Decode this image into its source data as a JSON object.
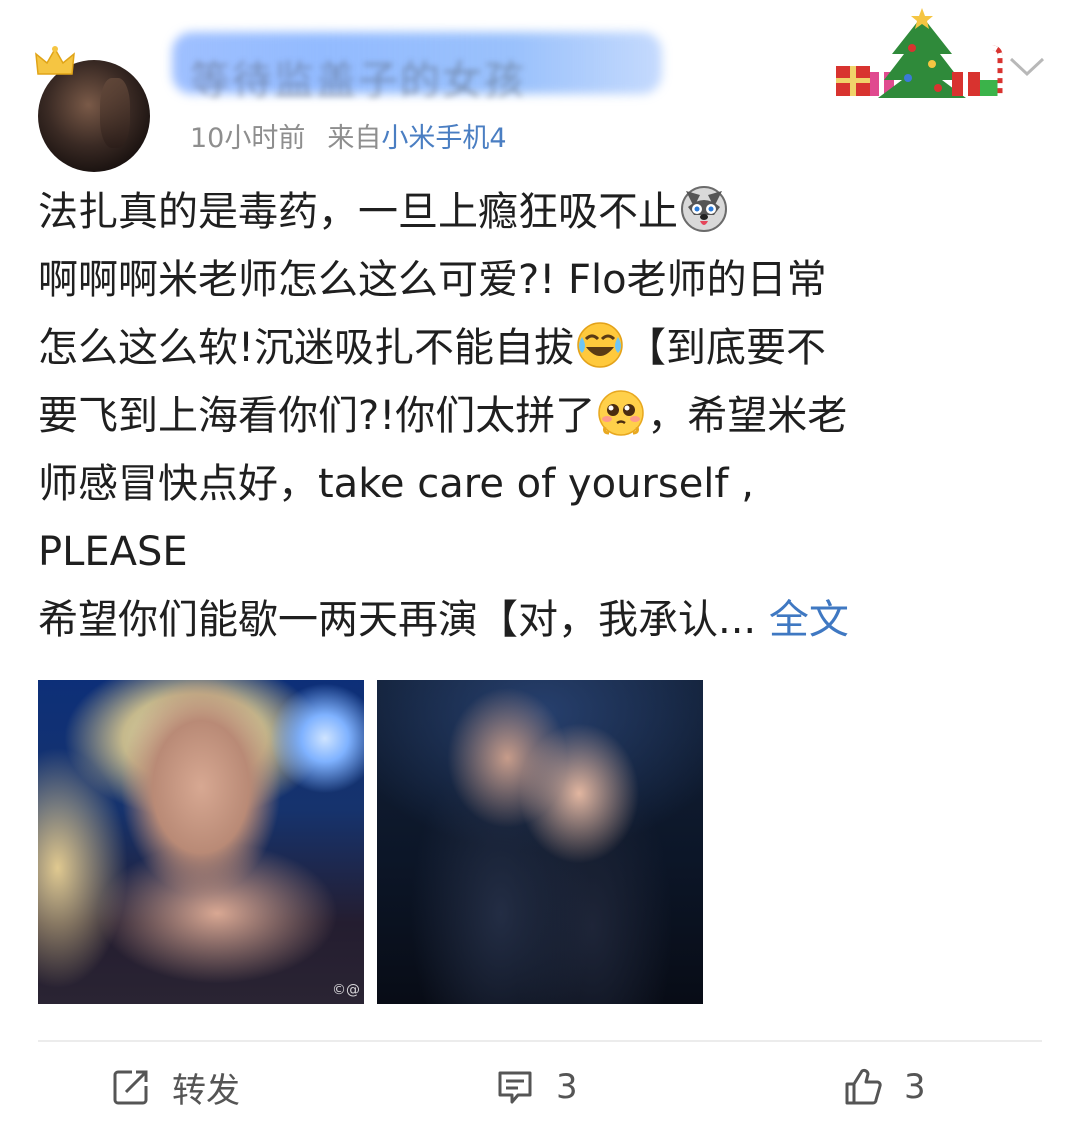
{
  "header": {
    "username_obscured": "等待监盖子的女孩",
    "time": "10小时前",
    "source_prefix": "来自",
    "source": "小米手机4"
  },
  "post": {
    "lines": [
      "法扎真的是毒药，一旦上瘾狂吸不止",
      "啊啊啊米老师怎么这么可爱?!  Flo老师的日常",
      "怎么这么软!沉迷吸扎不能自拔",
      "【到底要不",
      "要飞到上海看你们?!你们太拼了",
      "，希望米老",
      "师感冒快点好，take care of yourself ,",
      "PLEASE",
      "希望你们能歇一两天再演【对，我承认... "
    ],
    "full_text_link": "全文",
    "emojis": [
      "husky-emoji",
      "laughing-crying-emoji",
      "pleading-emoji"
    ]
  },
  "photos": {
    "watermark": "©@"
  },
  "actions": {
    "repost_label": "转发",
    "comment_count": "3",
    "like_count": "3"
  },
  "colors": {
    "link": "#3f78c2",
    "meta": "#8e8e8e",
    "text": "#1f1f1f"
  }
}
